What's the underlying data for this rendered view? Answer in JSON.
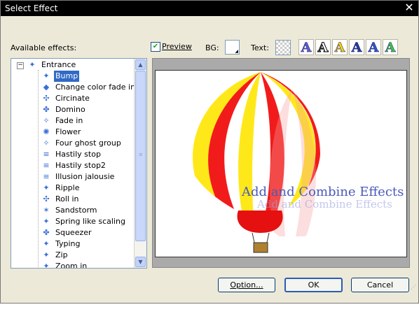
{
  "window": {
    "title": "Select Effect"
  },
  "labels": {
    "available_effects": "Available effects:",
    "preview": "Preview",
    "bg": "BG:",
    "text": "Text:"
  },
  "tree": {
    "root": "Entrance",
    "items": [
      "Bump",
      "Change color fade in",
      "Circinate",
      "Domino",
      "Fade in",
      "Flower",
      "Four ghost group",
      "Hastily stop",
      "Hastily stop2",
      "Illusion jalousie",
      "Ripple",
      "Roll in",
      "Sandstorm",
      "Spring like scaling",
      "Squeezer",
      "Typing",
      "Zip",
      "Zoom in"
    ],
    "selected": "Bump"
  },
  "preview": {
    "checked": true,
    "sample_text": "Add and Combine Effects"
  },
  "text_styles": [
    {
      "glyph": "A",
      "name": "outline-blue",
      "color": "#5a5fd0"
    },
    {
      "glyph": "A",
      "name": "outline-white",
      "color": "#ffffff"
    },
    {
      "glyph": "A",
      "name": "yellow",
      "color": "#f2d400"
    },
    {
      "glyph": "A",
      "name": "dark-blue",
      "color": "#223c9c"
    },
    {
      "glyph": "A",
      "name": "blue-shadow",
      "color": "#2d56c9"
    },
    {
      "glyph": "A",
      "name": "rainbow",
      "color": "#3cc83c"
    }
  ],
  "buttons": {
    "option": "Option...",
    "ok": "OK",
    "cancel": "Cancel"
  }
}
